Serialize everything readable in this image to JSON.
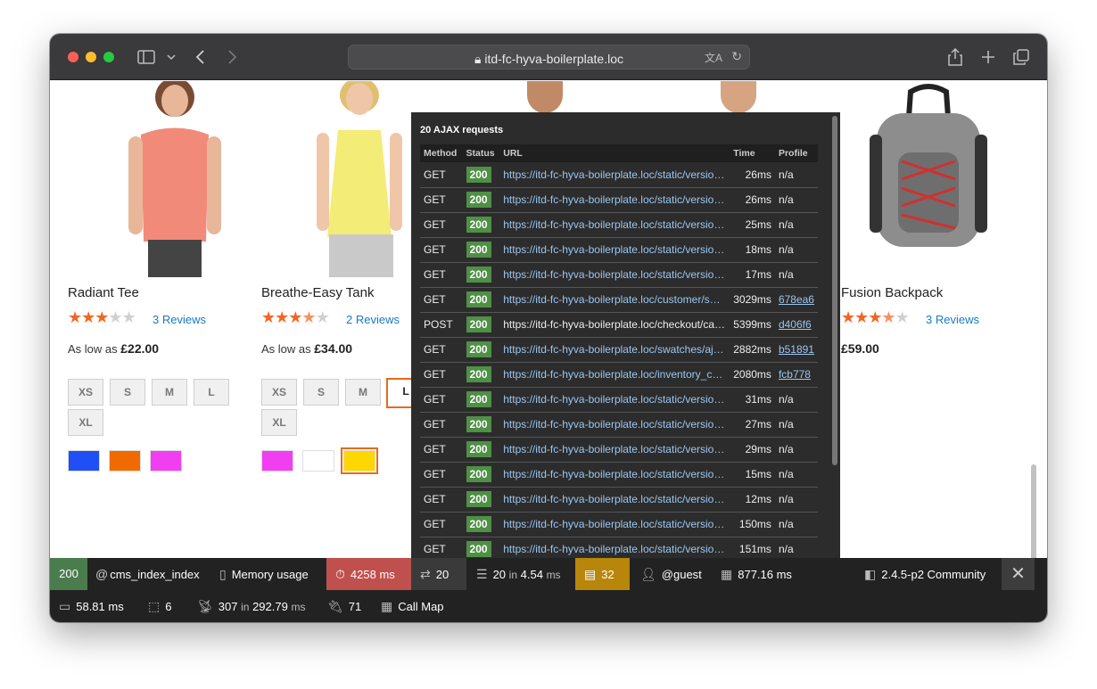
{
  "browser": {
    "url": "itd-fc-hyva-boilerplate.loc"
  },
  "products": [
    {
      "name": "Radiant Tee",
      "rating_stars": 3,
      "reviews": "3  Reviews",
      "price_prefix": "As low as",
      "price": "£22.00",
      "sizes": [
        "XS",
        "S",
        "M",
        "L",
        "XL"
      ],
      "swatches": [
        "#1f4ff5",
        "#f06a00",
        "#f23ef2"
      ]
    },
    {
      "name": "Breathe-Easy Tank",
      "rating_stars": 3.5,
      "reviews": "2  Reviews",
      "price_prefix": "As low as",
      "price": "£34.00",
      "sizes": [
        "XS",
        "S",
        "M",
        "L",
        "XL"
      ],
      "swatches": [
        "#f23ef2",
        "#ffffff",
        "#ffd700"
      ]
    },
    {
      "name": "Fusion Backpack",
      "rating_stars": 3.5,
      "reviews": "3  Reviews",
      "price": "£59.00"
    }
  ],
  "ajax": {
    "title": "20 AJAX requests",
    "columns": [
      "Method",
      "Status",
      "URL",
      "Time",
      "Profile"
    ],
    "rows": [
      {
        "method": "GET",
        "status": "200",
        "url": "https://itd-fc-hyva-boilerplate.loc/static/versio…",
        "time": "26ms",
        "profile": "n/a"
      },
      {
        "method": "GET",
        "status": "200",
        "url": "https://itd-fc-hyva-boilerplate.loc/static/versio…",
        "time": "26ms",
        "profile": "n/a"
      },
      {
        "method": "GET",
        "status": "200",
        "url": "https://itd-fc-hyva-boilerplate.loc/static/versio…",
        "time": "25ms",
        "profile": "n/a"
      },
      {
        "method": "GET",
        "status": "200",
        "url": "https://itd-fc-hyva-boilerplate.loc/static/versio…",
        "time": "18ms",
        "profile": "n/a"
      },
      {
        "method": "GET",
        "status": "200",
        "url": "https://itd-fc-hyva-boilerplate.loc/static/versio…",
        "time": "17ms",
        "profile": "n/a"
      },
      {
        "method": "GET",
        "status": "200",
        "url": "https://itd-fc-hyva-boilerplate.loc/customer/s…",
        "time": "3029ms",
        "profile": "678ea6"
      },
      {
        "method": "POST",
        "status": "200",
        "url": "https://itd-fc-hyva-boilerplate.loc/checkout/ca…",
        "time": "5399ms",
        "profile": "d406f6"
      },
      {
        "method": "GET",
        "status": "200",
        "url": "https://itd-fc-hyva-boilerplate.loc/swatches/aj…",
        "time": "2882ms",
        "profile": "b51891"
      },
      {
        "method": "GET",
        "status": "200",
        "url": "https://itd-fc-hyva-boilerplate.loc/inventory_c…",
        "time": "2080ms",
        "profile": "fcb778"
      },
      {
        "method": "GET",
        "status": "200",
        "url": "https://itd-fc-hyva-boilerplate.loc/static/versio…",
        "time": "31ms",
        "profile": "n/a"
      },
      {
        "method": "GET",
        "status": "200",
        "url": "https://itd-fc-hyva-boilerplate.loc/static/versio…",
        "time": "27ms",
        "profile": "n/a"
      },
      {
        "method": "GET",
        "status": "200",
        "url": "https://itd-fc-hyva-boilerplate.loc/static/versio…",
        "time": "29ms",
        "profile": "n/a"
      },
      {
        "method": "GET",
        "status": "200",
        "url": "https://itd-fc-hyva-boilerplate.loc/static/versio…",
        "time": "15ms",
        "profile": "n/a"
      },
      {
        "method": "GET",
        "status": "200",
        "url": "https://itd-fc-hyva-boilerplate.loc/static/versio…",
        "time": "12ms",
        "profile": "n/a"
      },
      {
        "method": "GET",
        "status": "200",
        "url": "https://itd-fc-hyva-boilerplate.loc/static/versio…",
        "time": "150ms",
        "profile": "n/a"
      },
      {
        "method": "GET",
        "status": "200",
        "url": "https://itd-fc-hyva-boilerplate.loc/static/versio…",
        "time": "151ms",
        "profile": "n/a"
      }
    ]
  },
  "toolbar": {
    "status": "200",
    "route": "cms_index_index",
    "memory": "Memory usage",
    "time": "4258 ms",
    "ajax_count": "20",
    "db_queries": "20",
    "db_in": "in",
    "db_time": "4.54",
    "db_unit": "ms",
    "messages": "32",
    "user": "@guest",
    "layout_time": "877.16 ms",
    "version": "2.4.5-p2 Community",
    "cache_time": "58.81 ms",
    "blocks": "6",
    "observers": "307",
    "obs_in": "in",
    "obs_time": "292.79",
    "obs_unit": "ms",
    "plugins": "71",
    "callmap": "Call Map",
    "colors": {
      "ok": "#4a7c4e",
      "time": "#c0504d",
      "messages": "#b8860b",
      "ajax": "#3a3a3a"
    }
  }
}
